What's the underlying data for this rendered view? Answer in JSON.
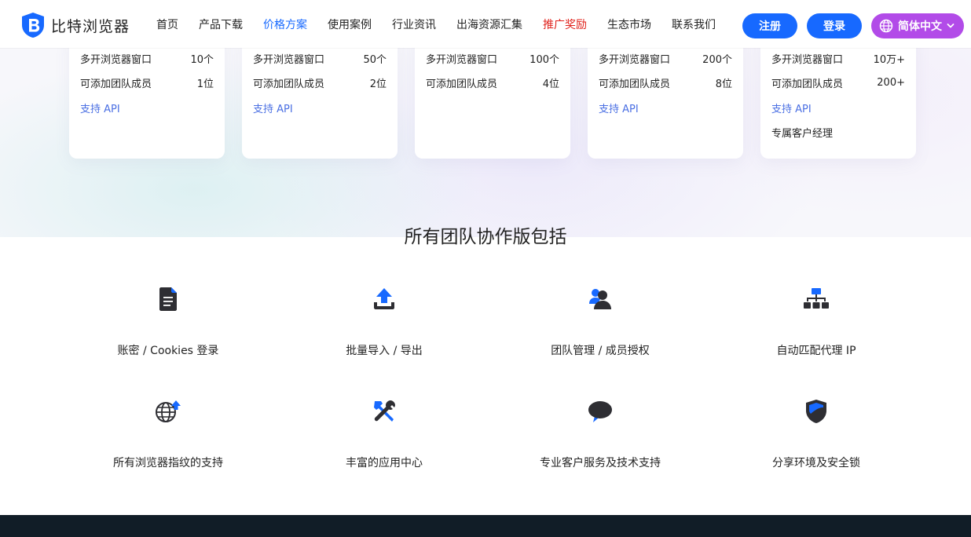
{
  "header": {
    "logo_text": "比特浏览器",
    "nav": [
      {
        "label": "首页"
      },
      {
        "label": "产品下载"
      },
      {
        "label": "价格方案"
      },
      {
        "label": "使用案例"
      },
      {
        "label": "行业资讯"
      },
      {
        "label": "出海资源汇集"
      },
      {
        "label": "推广奖励"
      },
      {
        "label": "生态市场"
      },
      {
        "label": "联系我们"
      }
    ],
    "active_nav": "价格方案",
    "register_label": "注册",
    "login_label": "登录",
    "lang_label": "简体中文"
  },
  "colors": {
    "primary": "#1769ff",
    "promo": "#e0201a",
    "lang_button": "#b24be8",
    "api_link": "#4a6fe3",
    "footer": "#111d27"
  },
  "plans": [
    {
      "windows_label": "多开浏览器窗口",
      "windows_value": "10个",
      "members_label": "可添加团队成员",
      "members_value": "1位",
      "api": "支持 API",
      "extra": ""
    },
    {
      "windows_label": "多开浏览器窗口",
      "windows_value": "50个",
      "members_label": "可添加团队成员",
      "members_value": "2位",
      "api": "支持 API",
      "extra": ""
    },
    {
      "windows_label": "多开浏览器窗口",
      "windows_value": "100个",
      "members_label": "可添加团队成员",
      "members_value": "4位",
      "api": "",
      "extra": ""
    },
    {
      "windows_label": "多开浏览器窗口",
      "windows_value": "200个",
      "members_label": "可添加团队成员",
      "members_value": "8位",
      "api": "支持 API",
      "extra": ""
    },
    {
      "windows_label": "多开浏览器窗口",
      "windows_value": "10万+",
      "members_label": "可添加团队成员",
      "members_value": "200+",
      "api": "支持 API",
      "extra": "专属客户经理"
    }
  ],
  "features_title": "所有团队协作版包括",
  "features": [
    {
      "label": "账密 / Cookies 登录",
      "icon": "document-icon"
    },
    {
      "label": "批量导入 / 导出",
      "icon": "upload-icon"
    },
    {
      "label": "团队管理 / 成员授权",
      "icon": "team-user-icon"
    },
    {
      "label": "自动匹配代理 IP",
      "icon": "network-icon"
    },
    {
      "label": "所有浏览器指纹的支持",
      "icon": "globe-arrow-icon"
    },
    {
      "label": "丰富的应用中心",
      "icon": "tools-icon"
    },
    {
      "label": "专业客户服务及技术支持",
      "icon": "chat-bubble-icon"
    },
    {
      "label": "分享环境及安全锁",
      "icon": "shield-icon"
    }
  ]
}
